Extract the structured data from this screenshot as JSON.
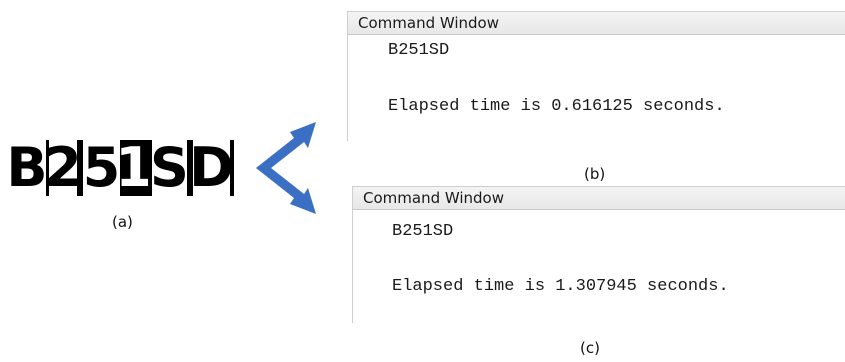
{
  "figure": {
    "plate_characters": [
      "B",
      "2",
      "5",
      "1",
      "S",
      "D"
    ],
    "captions": {
      "a": "(a)",
      "b": "(b)",
      "c": "(c)"
    },
    "arrow_color": "#3a6fc4"
  },
  "windows": [
    {
      "title": "Command Window",
      "output_line": "B251SD",
      "elapsed_line": "Elapsed time is 0.616125 seconds."
    },
    {
      "title": "Command Window",
      "output_line": "B251SD",
      "elapsed_line": "Elapsed time is 1.307945 seconds."
    }
  ]
}
